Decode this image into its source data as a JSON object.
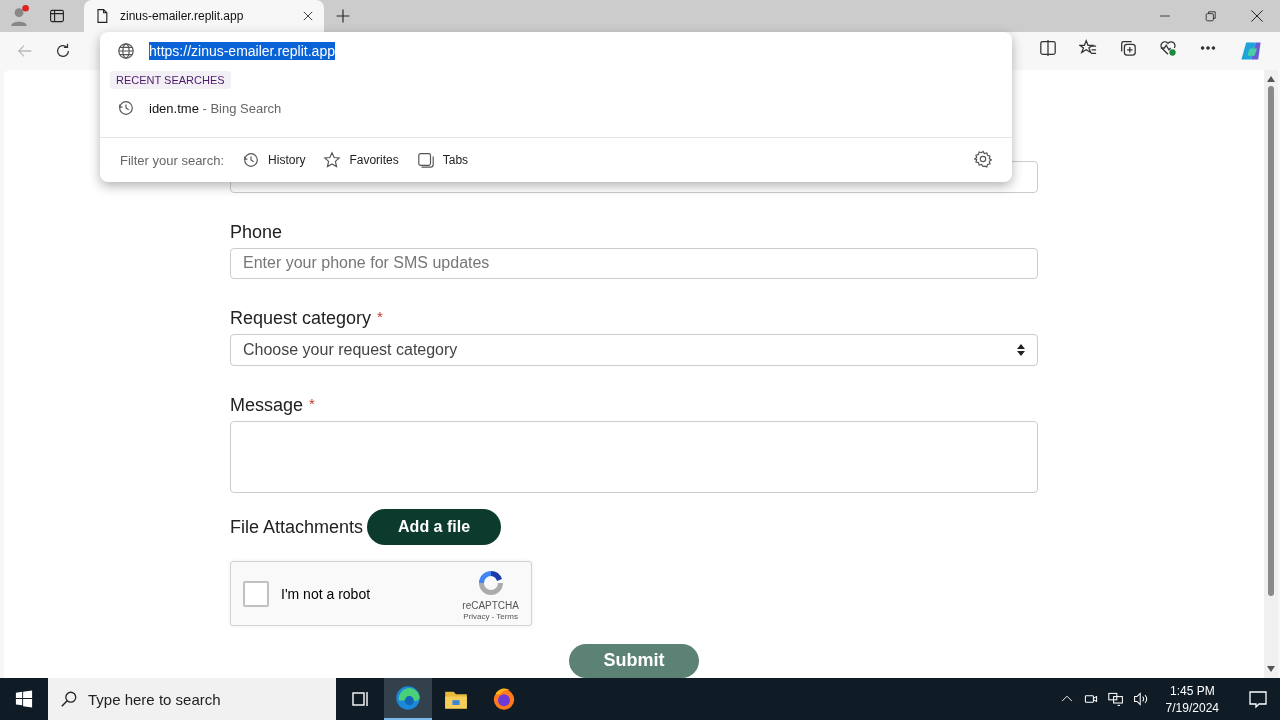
{
  "browser": {
    "tab": {
      "title": "zinus-emailer.replit.app"
    },
    "address_dropdown": {
      "url": "https://zinus-emailer.replit.app",
      "section_label": "RECENT SEARCHES",
      "suggestions": [
        {
          "query": "iden.tme",
          "source": "- Bing Search"
        }
      ],
      "filter_label": "Filter your search:",
      "filters": [
        "History",
        "Favorites",
        "Tabs"
      ]
    }
  },
  "form": {
    "required_mark": "*",
    "fields": [
      {
        "kind": "input"
      },
      {
        "kind": "input",
        "label": "Phone",
        "required": false,
        "placeholder": "Enter your phone for SMS updates"
      },
      {
        "kind": "select",
        "label": "Request category",
        "required": true,
        "value": "Choose your request category"
      },
      {
        "kind": "textarea",
        "label": "Message",
        "required": true
      }
    ],
    "attachments": {
      "label": "File Attachments",
      "button": "Add a file"
    },
    "captcha": {
      "label": "I'm not a robot",
      "checked": false,
      "brand": "reCAPTCHA",
      "links": [
        "Privacy",
        "Terms"
      ],
      "separator": "-"
    },
    "submit": "Submit"
  },
  "taskbar": {
    "search_placeholder": "Type here to search",
    "time": "1:45 PM",
    "date": "7/19/2024"
  }
}
